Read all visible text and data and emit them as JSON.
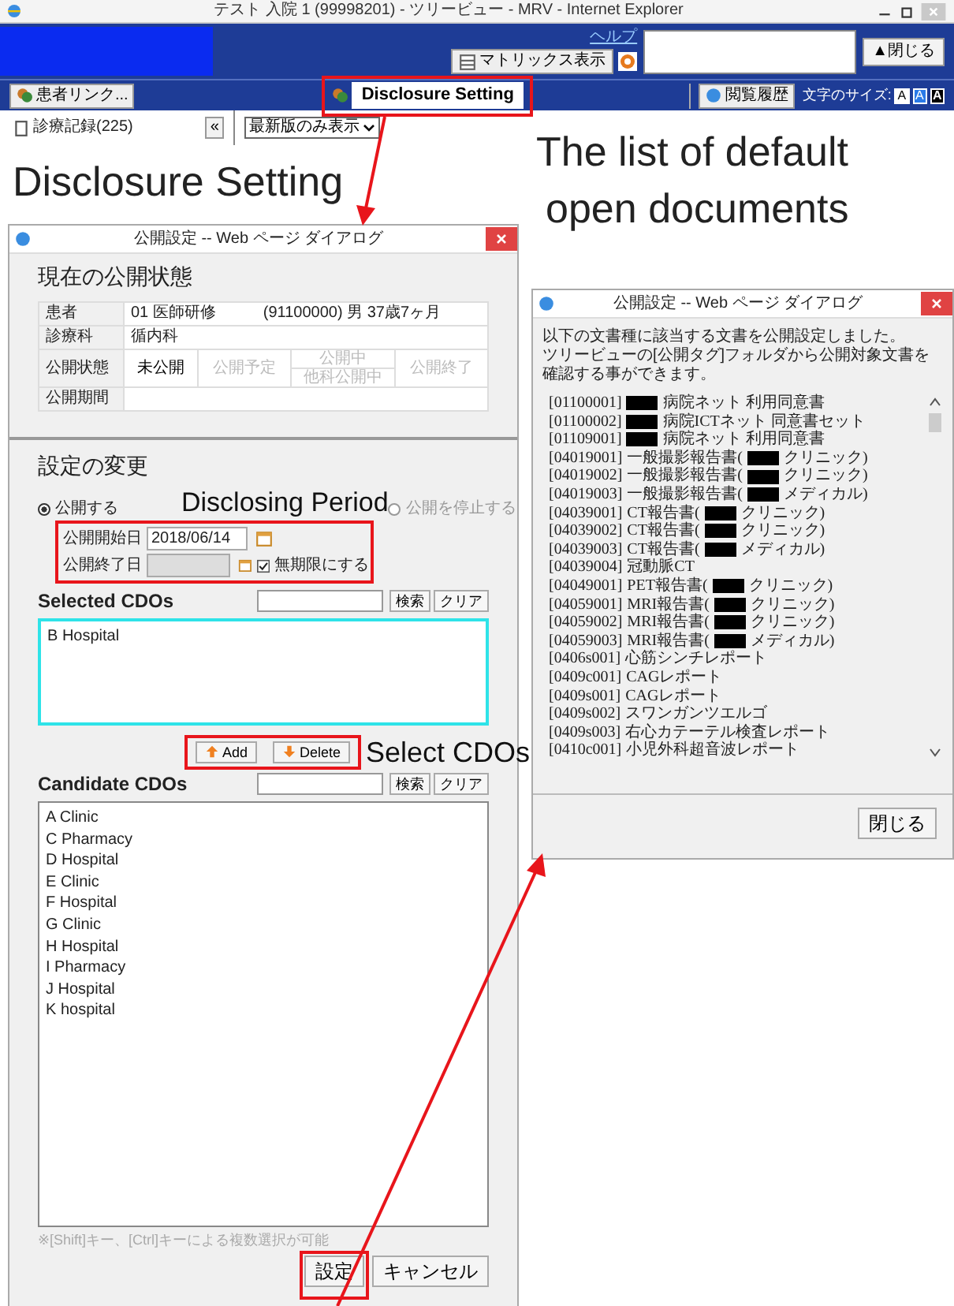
{
  "browser": {
    "title": "テスト 入院 1 (99998201) - ツリービュー - MRV - Internet Explorer",
    "help_link": "ヘルプ",
    "matrix_button": "マトリックス表示",
    "close_button": "▲閉じる",
    "toolbar": {
      "patient_link": "患者リンク...",
      "disclosure_tab": "Disclosure Setting",
      "history_button": "閲覧履歴",
      "font_size_label": "文字のサイズ:",
      "font_sizes": [
        {
          "label": "A",
          "selected": false
        },
        {
          "label": "A",
          "selected": true
        },
        {
          "label": "A",
          "selected": false
        }
      ]
    },
    "tree": {
      "item": "診療記録(225)",
      "collapse": "«",
      "filter": "最新版のみ表示"
    }
  },
  "headings": {
    "disclosure": "Disclosure Setting",
    "list": [
      "The list of default",
      "open documents"
    ]
  },
  "labels": {
    "period": "Disclosing Period",
    "select": "Select CDOs"
  },
  "setting_dialog": {
    "title": "公開設定 -- Web ページ ダイアログ",
    "current_heading": "現在の公開状態",
    "patient_label": "患者",
    "patient_name": "01 医師研修",
    "patient_info": "(91100000) 男 37歳7ヶ月",
    "dept_label": "診療科",
    "dept": "循内科",
    "status_label": "公開状態",
    "statuses": [
      {
        "label": "未公開",
        "active": true
      },
      {
        "label": "公開予定",
        "active": false
      },
      {
        "label": "公開中",
        "active": false
      },
      {
        "label": "他科公開中",
        "active": false
      },
      {
        "label": "公開終了",
        "active": false
      }
    ],
    "period_label": "公開期間",
    "change_heading": "設定の変更",
    "modes": [
      {
        "label": "公開する",
        "selected": true
      },
      {
        "label": "公開を停止する",
        "selected": false
      }
    ],
    "start_label": "公開開始日",
    "start_value": "2018/06/14",
    "end_label": "公開終了日",
    "end_disabled": true,
    "indefinite_label": "無期限にする",
    "indefinite_checked": true,
    "selected_heading": "Selected CDOs",
    "selected_search_button": "検索",
    "selected_clear_button": "クリア",
    "selected_items": [
      "B Hospital"
    ],
    "add_button": "Add",
    "delete_button": "Delete",
    "candidate_heading": "Candidate CDOs",
    "candidate_search_button": "検索",
    "candidate_clear_button": "クリア",
    "candidate_items": [
      "A Clinic",
      "C Pharmacy",
      "D Hospital",
      "E Clinic",
      "F Hospital",
      "G Clinic",
      "H Hospital",
      "I Pharmacy",
      "J Hospital",
      "K hospital"
    ],
    "note": "※[Shift]キー、[Ctrl]キーによる複数選択が可能",
    "ok_button": "設定",
    "cancel_button": "キャンセル"
  },
  "list_dialog": {
    "title": "公開設定 -- Web ページ ダイアログ",
    "message": [
      "以下の文書種に該当する文書を公開設定しました。",
      "ツリービューの[公開タグ]フォルダから公開対象文書を確認する事ができます。"
    ],
    "documents": [
      {
        "code": "[01100001]",
        "redacted": true,
        "after": "病院ネット 利用同意書"
      },
      {
        "code": "[01100002]",
        "redacted": true,
        "after": "病院ICTネット 同意書セット"
      },
      {
        "code": "[01109001]",
        "redacted": true,
        "after": "病院ネット 利用同意書"
      },
      {
        "code": "[04019001]",
        "before": "一般撮影報告書(",
        "redacted": true,
        "after": "クリニック)"
      },
      {
        "code": "[04019002]",
        "before": "一般撮影報告書(",
        "redacted": true,
        "after": "クリニック)"
      },
      {
        "code": "[04019003]",
        "before": "一般撮影報告書(",
        "redacted": true,
        "after": "メディカル)"
      },
      {
        "code": "[04039001]",
        "before": "CT報告書(",
        "redacted": true,
        "after": "クリニック)"
      },
      {
        "code": "[04039002]",
        "before": "CT報告書(",
        "redacted": true,
        "after": "クリニック)"
      },
      {
        "code": "[04039003]",
        "before": "CT報告書(",
        "redacted": true,
        "after": "メディカル)"
      },
      {
        "code": "[04039004]",
        "before": "冠動脈CT",
        "redacted": false
      },
      {
        "code": "[04049001]",
        "before": "PET報告書(",
        "redacted": true,
        "after": "クリニック)"
      },
      {
        "code": "[04059001]",
        "before": "MRI報告書(",
        "redacted": true,
        "after": "クリニック)"
      },
      {
        "code": "[04059002]",
        "before": "MRI報告書(",
        "redacted": true,
        "after": "クリニック)"
      },
      {
        "code": "[04059003]",
        "before": "MRI報告書(",
        "redacted": true,
        "after": "メディカル)"
      },
      {
        "code": "[0406s001]",
        "before": "心筋シンチレポート",
        "redacted": false
      },
      {
        "code": "[0409c001]",
        "before": "CAGレポート",
        "redacted": false
      },
      {
        "code": "[0409s001]",
        "before": "CAGレポート",
        "redacted": false
      },
      {
        "code": "[0409s002]",
        "before": "スワンガンツエルゴ",
        "redacted": false
      },
      {
        "code": "[0409s003]",
        "before": "右心カテーテル検査レポート",
        "redacted": false
      },
      {
        "code": "[0410c001]",
        "before": "小児外科超音波レポート",
        "redacted": false
      }
    ],
    "close_button": "閉じる"
  }
}
